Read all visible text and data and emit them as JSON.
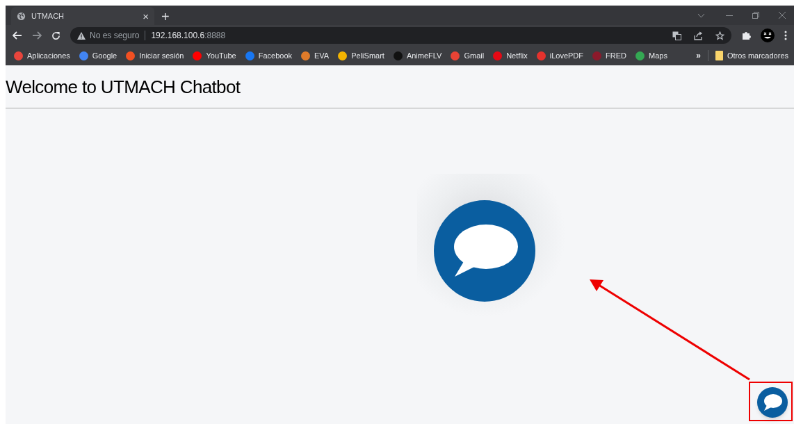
{
  "tab": {
    "title": "UTMACH",
    "close": "×",
    "new_tab": "+"
  },
  "address_bar": {
    "security": "No es seguro",
    "host": "192.168.100.6",
    "port": ":8888"
  },
  "bookmarks": [
    {
      "label": "Aplicaciones",
      "color": "#e8453c"
    },
    {
      "label": "Google",
      "color": "#4285f4"
    },
    {
      "label": "Iniciar sesión",
      "color": "#f25022"
    },
    {
      "label": "YouTube",
      "color": "#ff0000"
    },
    {
      "label": "Facebook",
      "color": "#1877f2"
    },
    {
      "label": "EVA",
      "color": "#e07b2a"
    },
    {
      "label": "PeliSmart",
      "color": "#f4b400"
    },
    {
      "label": "AnimeFLV",
      "color": "#111111"
    },
    {
      "label": "Gmail",
      "color": "#ea4335"
    },
    {
      "label": "Netflix",
      "color": "#e50914"
    },
    {
      "label": "iLovePDF",
      "color": "#e5322d"
    },
    {
      "label": "FRED",
      "color": "#8b1a2b"
    },
    {
      "label": "Maps",
      "color": "#34a853"
    }
  ],
  "bookmarks_overflow": "»",
  "other_bookmarks": "Otros marcadores",
  "page": {
    "heading": "Welcome to UTMACH Chatbot"
  }
}
